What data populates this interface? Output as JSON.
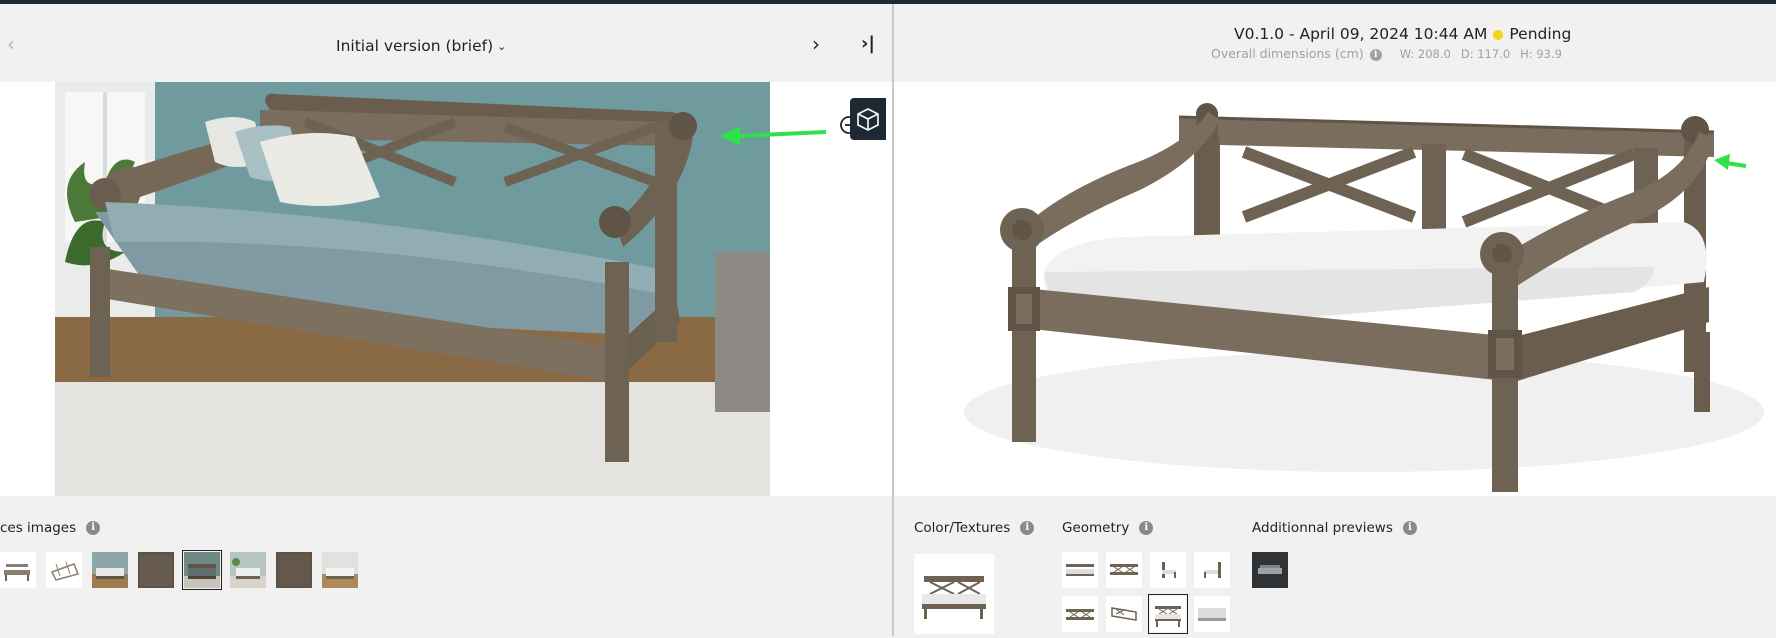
{
  "left": {
    "nav": {
      "prev": "‹",
      "version": "Initial version (brief)",
      "next": "›",
      "last": "›|"
    },
    "refs_label": "ces images",
    "refs_info": "i"
  },
  "right": {
    "version_line": "V0.1.0 - April 09, 2024 10:44 AM",
    "status": "Pending",
    "status_color": "#f6d21a",
    "dims_label": "Overall dimensions (cm)",
    "dims_info": "i",
    "width": "W: 208.0",
    "depth": "D: 117.0",
    "height": "H: 93.9",
    "color_label": "Color/Textures",
    "geometry_label": "Geometry",
    "previews_label": "Additionnal previews",
    "info": "i"
  },
  "colors": {
    "accent_arrow": "#2ee04a",
    "wood": "#6e6253",
    "cushion_blue": "#7f9aa2",
    "cushion_white": "#f2f2f2",
    "dark": "#1f2933"
  },
  "icons": [
    "chevron-left-icon",
    "chevron-down-icon",
    "chevron-right-icon",
    "skip-end-icon",
    "zoom-out-icon",
    "info-icon",
    "cube-icon",
    "arrow-annotation-icon"
  ]
}
